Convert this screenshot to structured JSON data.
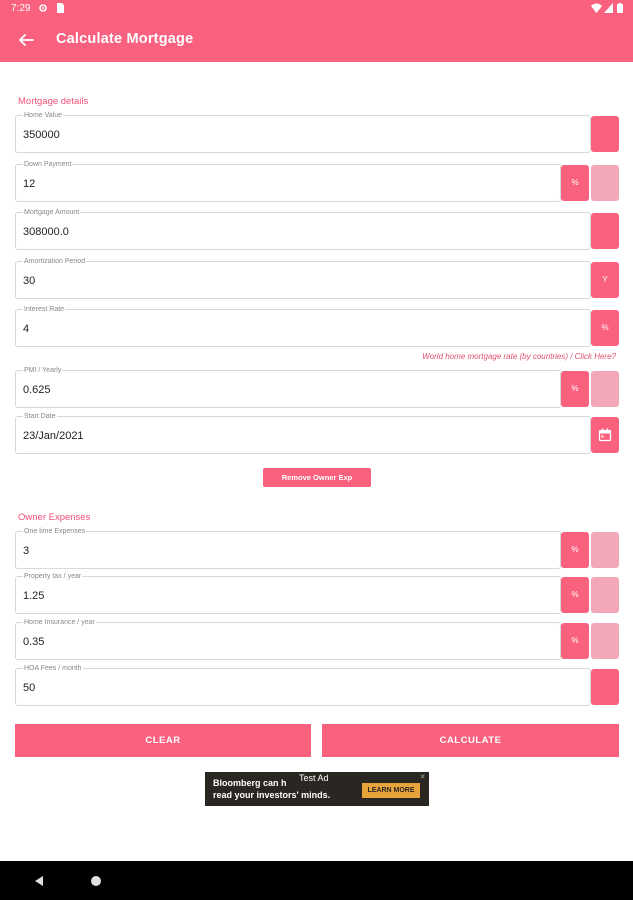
{
  "status": {
    "time": "7:29"
  },
  "header": {
    "title": "Calculate Mortgage"
  },
  "mortgage": {
    "section_title": "Mortgage details",
    "home_value": {
      "label": "Home Value",
      "value": "350000"
    },
    "down_payment": {
      "label": "Down Payment",
      "value": "12",
      "unit": "%"
    },
    "mortgage_amount": {
      "label": "Mortgage Amount",
      "value": "308000.0"
    },
    "amortization": {
      "label": "Amortization Period",
      "value": "30",
      "unit": "Y"
    },
    "interest": {
      "label": "Interest Rate",
      "value": "4",
      "unit": "%"
    },
    "rate_link": "World home mortgage rate (by countries) / Click Here?",
    "pmi": {
      "label": "PMI / Yearly",
      "value": "0.625",
      "unit": "%"
    },
    "start_date": {
      "label": "Start Date",
      "value": "23/Jan/2021"
    }
  },
  "remove_owner_exp": "Remove Owner Exp",
  "owner": {
    "section_title": "Owner Expenses",
    "one_time": {
      "label": "One time Expenses",
      "value": "3",
      "unit": "%"
    },
    "property_tax": {
      "label": "Property tax / year",
      "value": "1.25",
      "unit": "%"
    },
    "home_insurance": {
      "label": "Home Insurance / year",
      "value": "0.35",
      "unit": "%"
    },
    "hoa": {
      "label": "HOA Fees / month",
      "value": "50"
    }
  },
  "actions": {
    "clear": "CLEAR",
    "calculate": "CALCULATE"
  },
  "ad": {
    "text_line1": "Bloomberg can h",
    "text_line2": "read your investors' minds.",
    "tag": "Test Ad",
    "cta": "LEARN MORE",
    "close": "✕"
  },
  "colors": {
    "accent": "#f9617f",
    "accent_light": "#f2a8b7",
    "section_text": "#f0507a"
  },
  "icons": [
    "back-arrow-icon",
    "gear-icon",
    "sim-card-icon",
    "wifi-icon",
    "signal-icon",
    "battery-icon",
    "calendar-icon",
    "nav-back-icon",
    "nav-home-icon"
  ]
}
